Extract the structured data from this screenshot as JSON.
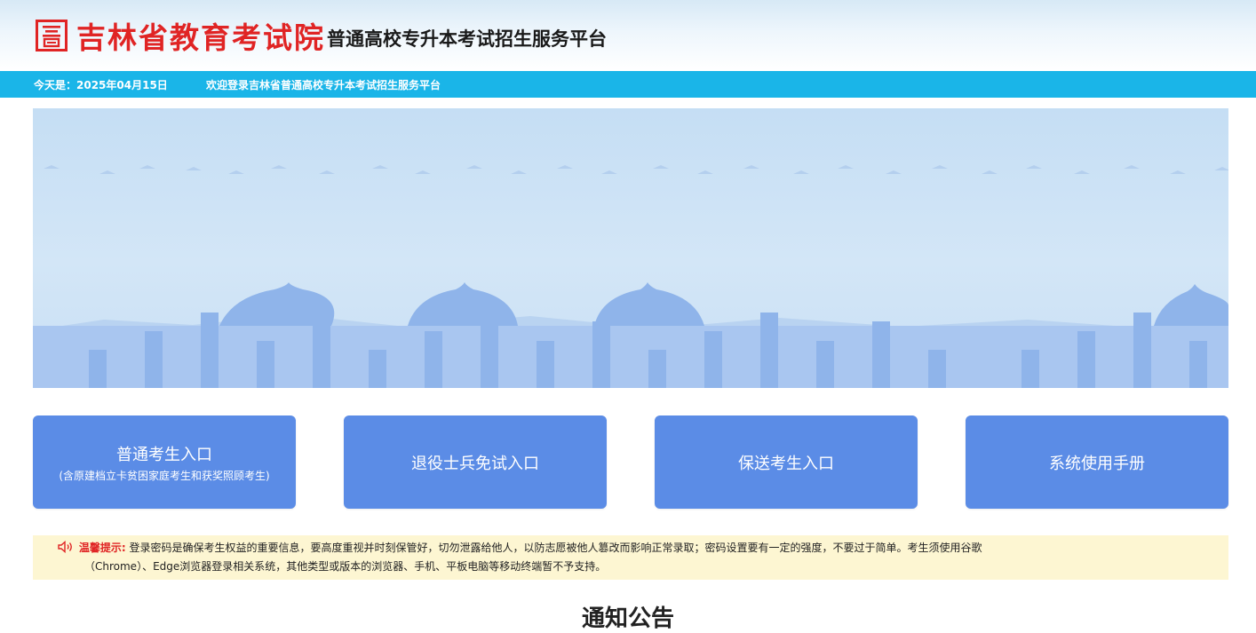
{
  "header": {
    "org_name": "吉林省教育考试院",
    "platform_name": "普通高校专升本考试招生服务平台",
    "logo_icon": "seal-logo-icon",
    "brand_color": "#e02424"
  },
  "info_bar": {
    "date_text": "今天是：2025年04月15日",
    "welcome_text": "欢迎登录吉林省普通高校专升本考试招生服务平台",
    "background_color": "#1ab5e8"
  },
  "entries": [
    {
      "label": "普通考生入口",
      "sublabel": "(含原建档立卡贫困家庭考生和获奖照顾考生)"
    },
    {
      "label": "退役士兵免试入口"
    },
    {
      "label": "保送考生入口"
    },
    {
      "label": "系统使用手册"
    }
  ],
  "notice": {
    "icon": "speaker-icon",
    "label": "温馨提示:",
    "line1": "登录密码是确保考生权益的重要信息，要高度重视并时刻保管好，切勿泄露给他人，以防志愿被他人篡改而影响正常录取；密码设置要有一定的强度，不要过于简单。考生须使用谷歌",
    "line2": "（Chrome）、Edge浏览器登录相关系统，其他类型或版本的浏览器、手机、平板电脑等移动终端暂不予支持。"
  },
  "section": {
    "title": "通知公告"
  }
}
